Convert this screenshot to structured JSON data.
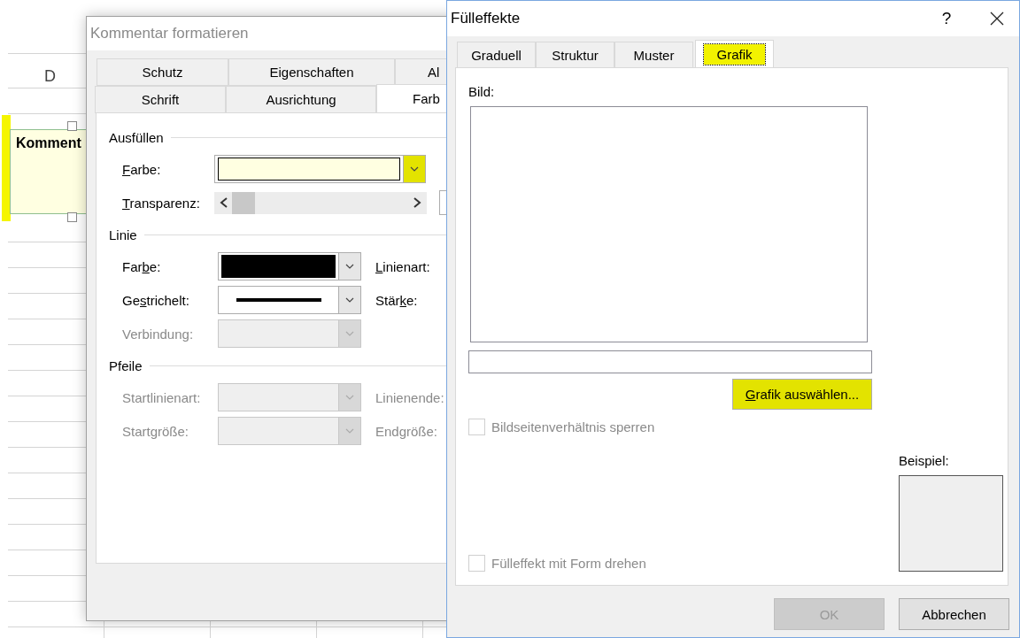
{
  "sheet": {
    "column_header": "D",
    "comment": {
      "text": "Komment",
      "highlighted": true
    }
  },
  "format_dialog": {
    "title": "Kommentar formatieren",
    "tab_rows": [
      [
        {
          "label": "Schutz",
          "selected": false
        },
        {
          "label": "Eigenschaften",
          "selected": false
        },
        {
          "label": "Al",
          "selected": false
        }
      ],
      [
        {
          "label": "Schrift",
          "selected": false
        },
        {
          "label": "Ausrichtung",
          "selected": false
        },
        {
          "label": "Farb",
          "selected": true
        }
      ]
    ],
    "sections": [
      {
        "title": "Ausfüllen",
        "rows": [
          {
            "kind": "color",
            "label": {
              "key": "F",
              "after": "arbe:"
            },
            "disabled": false,
            "color": "#ffffe1",
            "arrow_highlighted": true
          },
          {
            "kind": "slider",
            "label": {
              "key": "T",
              "after": "ransparenz:"
            },
            "disabled": false
          }
        ]
      },
      {
        "title": "Linie",
        "rows": [
          {
            "kind": "color",
            "label": {
              "before": "Far",
              "key": "b",
              "after": "e:"
            },
            "disabled": false,
            "color": "#000000",
            "arrow_highlighted": false,
            "side_label": {
              "key": "L",
              "after": "inienart:"
            }
          },
          {
            "kind": "dash",
            "label": {
              "before": "Ge",
              "key": "s",
              "after": "trichelt:"
            },
            "disabled": false,
            "side_label": {
              "before": "Stär",
              "key": "k",
              "after": "e:"
            }
          },
          {
            "kind": "combo",
            "label": {
              "before": "Verbindung:"
            },
            "disabled": true
          }
        ]
      },
      {
        "title": "Pfeile",
        "rows": [
          {
            "kind": "combo",
            "label": {
              "before": "Startlinienart:"
            },
            "disabled": true,
            "side_label": {
              "before": "Linienende:"
            }
          },
          {
            "kind": "combo",
            "label": {
              "before": "Startgröße:"
            },
            "disabled": true,
            "side_label": {
              "before": "Endgröße:"
            }
          }
        ]
      }
    ]
  },
  "fill_dialog": {
    "title": "Fülleffekte",
    "help": "?",
    "tabs": [
      {
        "label": "Graduell",
        "selected": false,
        "highlighted": false
      },
      {
        "label": "Struktur",
        "selected": false,
        "highlighted": false
      },
      {
        "label": "Muster",
        "selected": false,
        "highlighted": false
      },
      {
        "label": "Grafik",
        "selected": true,
        "highlighted": true
      }
    ],
    "picture_label": "Bild:",
    "select_button": {
      "label": {
        "key": "G",
        "after": "rafik auswählen..."
      },
      "highlighted": true
    },
    "lock_ratio": {
      "label": "Bildseitenverhältnis sperren",
      "checked": false,
      "disabled": true
    },
    "rotate": {
      "label": "Fülleffekt mit Form drehen",
      "checked": false,
      "disabled": true
    },
    "sample_label": "Beispiel:",
    "buttons": [
      {
        "label": "OK",
        "disabled": true
      },
      {
        "label": "Abbrechen",
        "disabled": false
      }
    ]
  }
}
